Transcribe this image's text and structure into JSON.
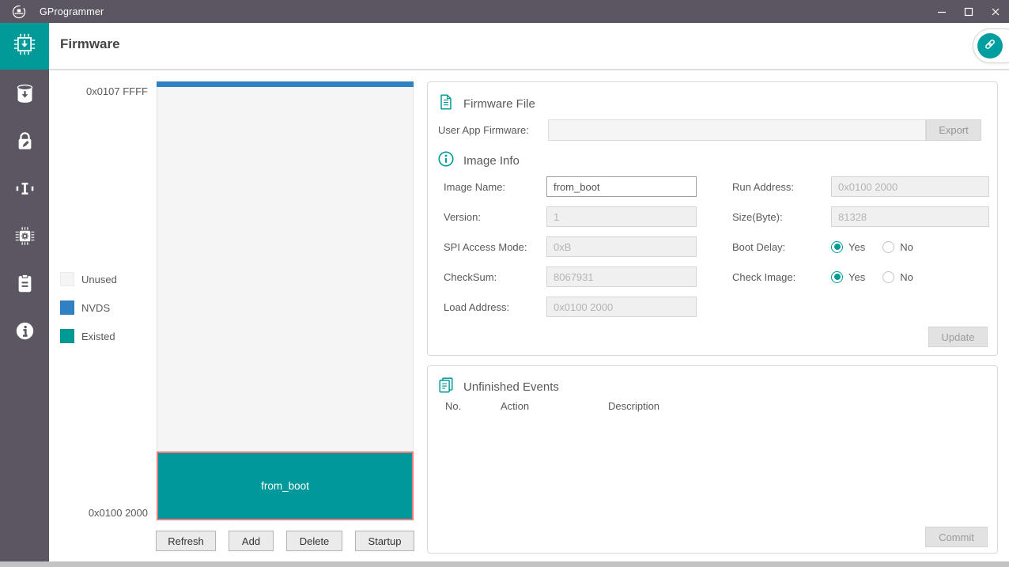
{
  "accent_color": "#009b99",
  "window": {
    "title": "GProgrammer"
  },
  "header": {
    "title": "Firmware"
  },
  "sidebar": {
    "items": [
      {
        "id": "firmware",
        "icon": "chip-download-icon",
        "selected": true
      },
      {
        "id": "flash",
        "icon": "flash-download-icon",
        "selected": false
      },
      {
        "id": "encrypt-sign",
        "icon": "lock-pencil-icon",
        "selected": false
      },
      {
        "id": "device-connect",
        "icon": "connector-icon",
        "selected": false
      },
      {
        "id": "chip-config",
        "icon": "chip-gear-icon",
        "selected": false
      },
      {
        "id": "device-log",
        "icon": "clipboard-icon",
        "selected": false
      },
      {
        "id": "about",
        "icon": "info-icon",
        "selected": false
      }
    ]
  },
  "memory_map": {
    "top_address": "0x0107 FFFF",
    "bottom_address": "0x0100 2000",
    "legend": [
      {
        "label": "Unused",
        "color": "#f5f5f5"
      },
      {
        "label": "NVDS",
        "color": "#2f81c4"
      },
      {
        "label": "Existed",
        "color": "#009a94"
      }
    ],
    "blocks": [
      {
        "name": "NVDS",
        "type": "nvds"
      },
      {
        "name": "Unused",
        "type": "unused"
      },
      {
        "name": "from_boot",
        "type": "existed",
        "selected": true
      }
    ],
    "buttons": {
      "refresh": "Refresh",
      "add": "Add",
      "delete": "Delete",
      "startup": "Startup"
    }
  },
  "firmware_file": {
    "title": "Firmware File",
    "user_app_label": "User App Firmware:",
    "user_app_value": "",
    "export_button": "Export"
  },
  "image_info": {
    "title": "Image Info",
    "fields_left": [
      {
        "label": "Image Name:",
        "value": "from_boot",
        "enabled": true
      },
      {
        "label": "Version:",
        "value": "1",
        "enabled": false
      },
      {
        "label": "SPI Access Mode:",
        "value": "0xB",
        "enabled": false
      },
      {
        "label": "CheckSum:",
        "value": "8067931",
        "enabled": false
      },
      {
        "label": "Load Address:",
        "value": "0x0100 2000",
        "enabled": false
      }
    ],
    "fields_right": [
      {
        "label": "Run Address:",
        "value": "0x0100 2000",
        "enabled": false
      },
      {
        "label": "Size(Byte):",
        "value": "81328",
        "enabled": false
      }
    ],
    "radios": [
      {
        "label": "Boot Delay:",
        "options": [
          "Yes",
          "No"
        ],
        "selected": "Yes"
      },
      {
        "label": "Check Image:",
        "options": [
          "Yes",
          "No"
        ],
        "selected": "Yes"
      }
    ],
    "update_button": "Update"
  },
  "unfinished_events": {
    "title": "Unfinished Events",
    "columns": [
      "No.",
      "Action",
      "Description"
    ],
    "rows": [],
    "commit_button": "Commit"
  }
}
